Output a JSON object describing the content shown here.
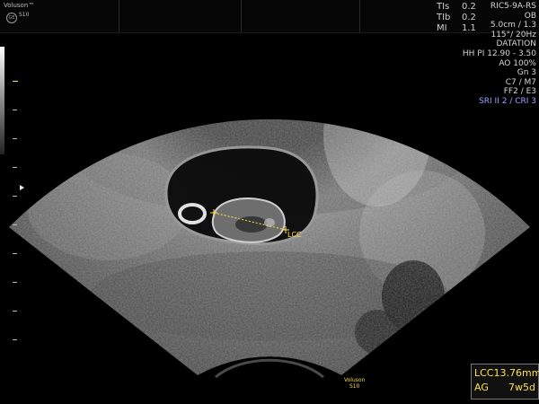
{
  "brand": {
    "name": "Voluson™",
    "model": "S10",
    "logo": "GE"
  },
  "indices": [
    {
      "label": "TIs",
      "value": "0.2"
    },
    {
      "label": "TIb",
      "value": "0.2"
    },
    {
      "label": "MI",
      "value": "1.1"
    }
  ],
  "probe_params": [
    "RIC5-9A-RS",
    "OB",
    "5.0cm / 1.3",
    "115°/ 20Hz",
    "DATATION",
    "HH PI 12.90 - 3.50",
    "AO 100%",
    "Gn  3",
    "C7 / M7",
    "FF2 / E3"
  ],
  "sri_setting": "SRI II 2 / CRI 3",
  "caliper_label": "LCC",
  "watermark": {
    "line1": "Voluson",
    "line2": "S10"
  },
  "measurement": {
    "rows": [
      {
        "name": "LCC",
        "value": "13.76mm"
      },
      {
        "name": "AG",
        "value": "7w5d"
      }
    ]
  },
  "colors": {
    "caliper": "#ffe24a",
    "sri": "#9aa0ff",
    "panel_border": "#777777"
  }
}
